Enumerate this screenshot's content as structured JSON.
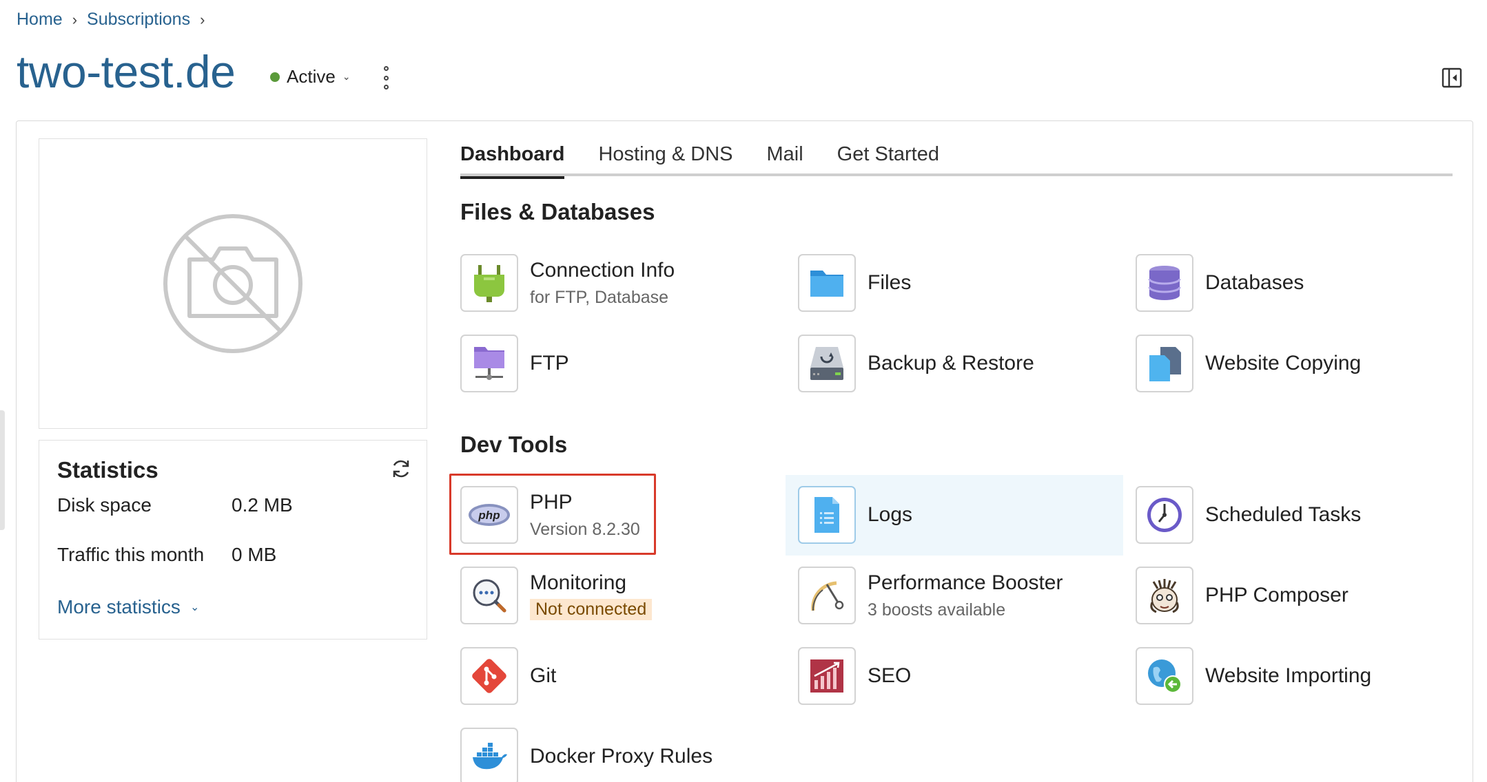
{
  "breadcrumb": {
    "home": "Home",
    "subscriptions": "Subscriptions"
  },
  "title": "two-test.de",
  "status": {
    "label": "Active",
    "color": "#5a9a3a"
  },
  "tabs": [
    "Dashboard",
    "Hosting & DNS",
    "Mail",
    "Get Started"
  ],
  "statistics": {
    "title": "Statistics",
    "disk_label": "Disk space",
    "disk_value": "0.2 MB",
    "traffic_label": "Traffic this month",
    "traffic_value": "0 MB",
    "more": "More statistics"
  },
  "sections": {
    "files_title": "Files & Databases",
    "dev_title": "Dev Tools"
  },
  "files": {
    "connection": {
      "name": "Connection Info",
      "sub": "for FTP, Database",
      "icon": "plug-icon"
    },
    "files": {
      "name": "Files",
      "icon": "folder-icon"
    },
    "databases": {
      "name": "Databases",
      "icon": "database-icon"
    },
    "ftp": {
      "name": "FTP",
      "icon": "ftp-folder-icon"
    },
    "backup": {
      "name": "Backup & Restore",
      "icon": "backup-drive-icon"
    },
    "copying": {
      "name": "Website Copying",
      "icon": "copy-pages-icon"
    }
  },
  "dev": {
    "php": {
      "name": "PHP",
      "sub": "Version 8.2.30",
      "icon": "php-icon"
    },
    "logs": {
      "name": "Logs",
      "icon": "log-file-icon"
    },
    "scheduled": {
      "name": "Scheduled Tasks",
      "icon": "clock-icon"
    },
    "monitoring": {
      "name": "Monitoring",
      "badge": "Not connected",
      "icon": "magnifier-icon"
    },
    "booster": {
      "name": "Performance Booster",
      "sub": "3 boosts available",
      "icon": "gauge-icon"
    },
    "composer": {
      "name": "PHP Composer",
      "icon": "composer-icon"
    },
    "git": {
      "name": "Git",
      "icon": "git-icon"
    },
    "seo": {
      "name": "SEO",
      "icon": "seo-chart-icon"
    },
    "importing": {
      "name": "Website Importing",
      "icon": "globe-import-icon"
    },
    "docker": {
      "name": "Docker Proxy Rules",
      "icon": "docker-icon"
    }
  },
  "colors": {
    "accent": "#28628f",
    "highlight": "#d83a2a",
    "hover": "#eef7fc"
  }
}
